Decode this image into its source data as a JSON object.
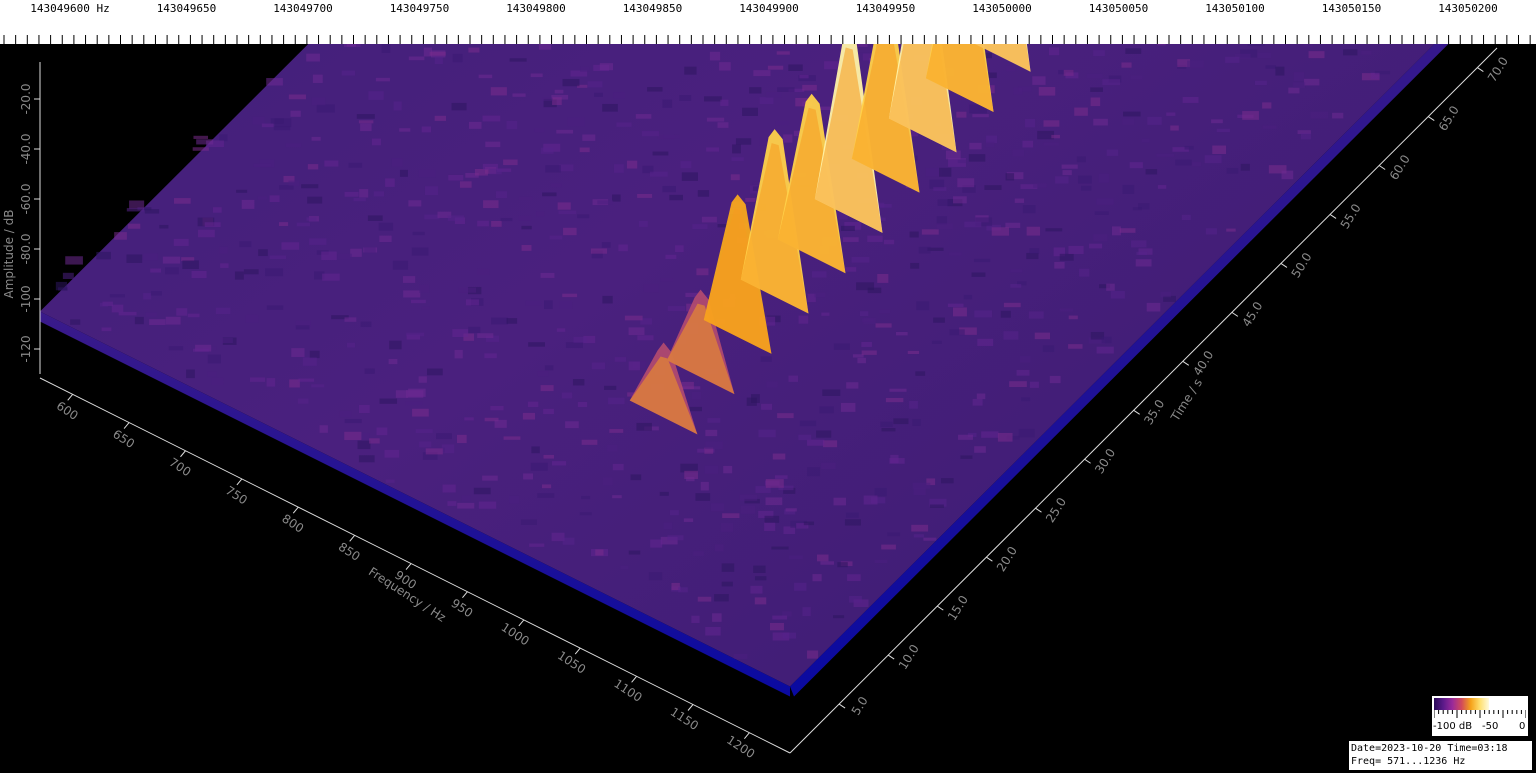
{
  "top_scale": {
    "unit": "Hz",
    "ticks": [
      "143049600",
      "143049650",
      "143049700",
      "143049750",
      "143049800",
      "143049850",
      "143049900",
      "143049950",
      "143050000",
      "143050050",
      "143050100",
      "143050150",
      "143050200"
    ]
  },
  "legend": {
    "min_label": "-100 dB",
    "mid_label": "-50",
    "max_label": "0",
    "colors": [
      "#2a0a58",
      "#5b1a8a",
      "#9a2a9a",
      "#d24a5a",
      "#f5a21a",
      "#ffe070",
      "#fffbe0"
    ]
  },
  "info": {
    "date_line": "Date=2023-10-20 Time=03:18",
    "freq_line": "Freq= 571...1236 Hz"
  },
  "chart_data": {
    "type": "heatmap",
    "title": "",
    "zlabel": "Amplitude / dB",
    "xlabel": "Frequency / Hz",
    "ylabel": "Time / s",
    "x_ticks": [
      600,
      650,
      700,
      750,
      800,
      850,
      900,
      950,
      1000,
      1050,
      1100,
      1150,
      1200
    ],
    "x_tick_labels": [
      "600",
      "650",
      "700",
      "750",
      "800",
      "850",
      "900",
      "950",
      "1000",
      "1050",
      "1100",
      "1150",
      "1200"
    ],
    "y_ticks": [
      5,
      10,
      15,
      20,
      25,
      30,
      35,
      40,
      45,
      50,
      55,
      60,
      65,
      70
    ],
    "y_tick_labels": [
      "5.0",
      "10.0",
      "15.0",
      "20.0",
      "25.0",
      "30.0",
      "35.0",
      "40.0",
      "45.0",
      "50.0",
      "55.0",
      "60.0",
      "65.0",
      "70.0"
    ],
    "z_ticks": [
      -20,
      -40,
      -60,
      -80,
      -100,
      -120
    ],
    "z_tick_labels": [
      "-20.0",
      "-40.0",
      "-60.0",
      "-80.0",
      "-100",
      "-120"
    ],
    "xlim": [
      571,
      1236
    ],
    "ylim": [
      0,
      72
    ],
    "zlim": [
      -130,
      -10
    ],
    "noise_floor_db": -105,
    "signal_trace": {
      "name": "",
      "time_s": [
        14,
        18,
        22,
        26,
        30,
        34,
        38,
        42,
        46,
        50,
        54,
        58,
        62,
        66,
        70
      ],
      "frequency_hz": [
        1002,
        1000,
        998,
        996,
        994,
        992,
        990,
        988,
        986,
        984,
        982,
        980,
        978,
        976,
        974
      ],
      "amplitude_db": [
        -75,
        -70,
        -48,
        -38,
        -40,
        -32,
        -36,
        -30,
        -34,
        -30,
        -28,
        -34,
        -26,
        -44,
        -50
      ]
    }
  }
}
